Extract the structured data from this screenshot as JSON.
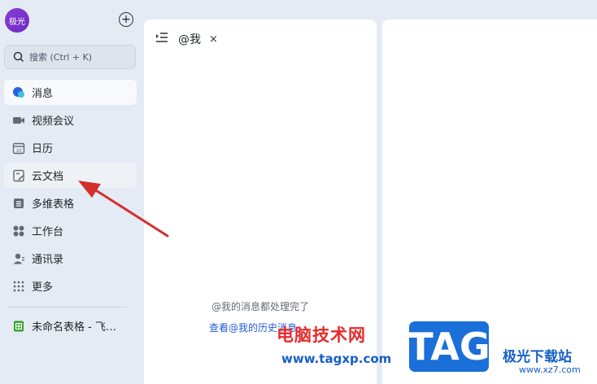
{
  "user": {
    "avatar_text": "极光"
  },
  "search": {
    "placeholder": "搜索 (Ctrl + K)"
  },
  "sidebar": {
    "items": [
      {
        "label": "消息",
        "icon": "message-icon"
      },
      {
        "label": "视频会议",
        "icon": "video-icon"
      },
      {
        "label": "日历",
        "icon": "calendar-icon",
        "icon_text": "10"
      },
      {
        "label": "云文档",
        "icon": "doc-icon"
      },
      {
        "label": "多维表格",
        "icon": "base-icon"
      },
      {
        "label": "工作台",
        "icon": "workspace-icon"
      },
      {
        "label": "通讯录",
        "icon": "contacts-icon"
      },
      {
        "label": "更多",
        "icon": "more-icon"
      }
    ],
    "recent": [
      {
        "label": "未命名表格 - 飞…",
        "icon": "sheet-icon"
      }
    ]
  },
  "panel": {
    "title": "@我",
    "close_glyph": "×",
    "empty_message": "@我的消息都处理完了",
    "history_link": "查看@我的历史消息"
  },
  "watermark": {
    "site_cn": "电脑技术网",
    "site_url": "www.tagxp.com",
    "logo_text": "TAG",
    "brand_cn": "极光下载站",
    "brand_url": "www.xz7.com"
  },
  "colors": {
    "background": "#e4ebf4",
    "accent": "#245bdb",
    "annotation_arrow": "#d32f2f",
    "avatar": "#7a33cf"
  }
}
